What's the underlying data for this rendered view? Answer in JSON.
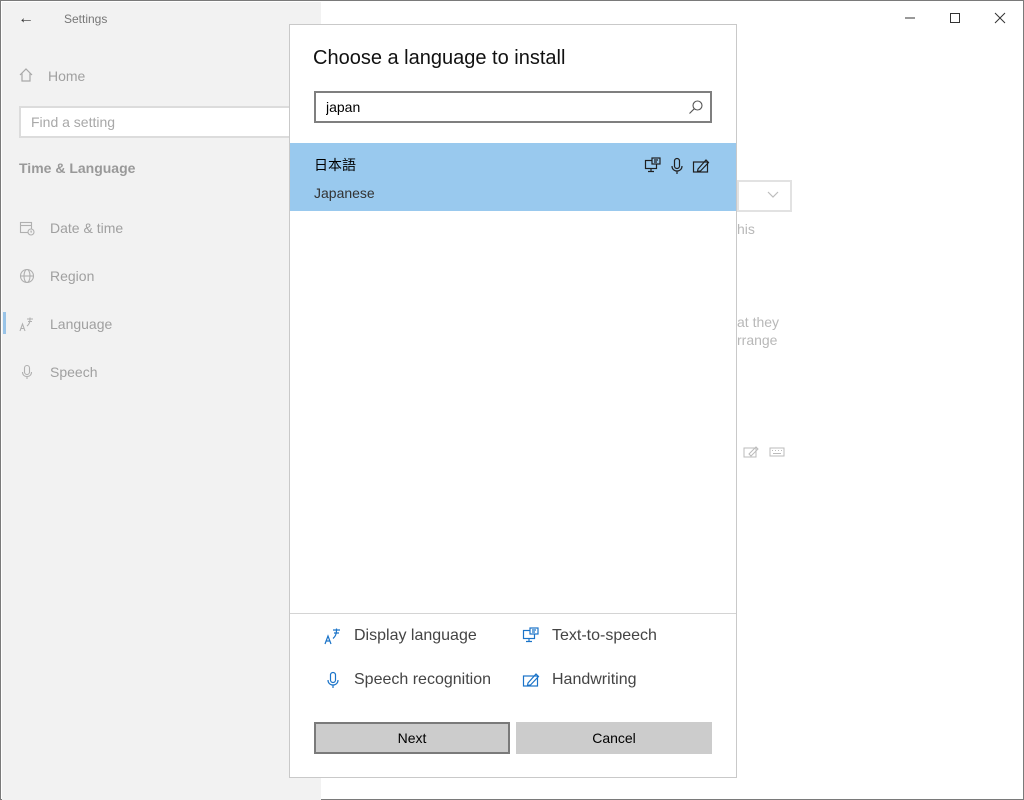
{
  "window": {
    "app_title": "Settings",
    "back_glyph": "←",
    "minimize_glyph": "—",
    "maximize_glyph": "☐",
    "close_glyph": "✕"
  },
  "sidebar": {
    "home_label": "Home",
    "search_placeholder": "Find a setting",
    "section_title": "Time & Language",
    "items": [
      {
        "label": "Date & time",
        "icon": "calendar-clock-icon"
      },
      {
        "label": "Region",
        "icon": "globe-icon"
      },
      {
        "label": "Language",
        "icon": "language-icon",
        "active": true
      },
      {
        "label": "Speech",
        "icon": "microphone-icon"
      }
    ]
  },
  "background": {
    "text_1": "his",
    "text_2": "at they",
    "text_3": "rrange"
  },
  "dialog": {
    "title": "Choose a language to install",
    "search_value": "japan",
    "results": [
      {
        "native": "日本語",
        "english": "Japanese",
        "features": [
          "text-to-speech",
          "speech-recognition",
          "handwriting"
        ]
      }
    ],
    "legend": {
      "display_language": "Display language",
      "text_to_speech": "Text-to-speech",
      "speech_recognition": "Speech recognition",
      "handwriting": "Handwriting"
    },
    "next_label": "Next",
    "cancel_label": "Cancel"
  },
  "colors": {
    "selection": "#99c9ee",
    "accent_icon": "#1a73c8",
    "sidebar_bg": "#f2f2f2",
    "button_bg": "#cccccc"
  }
}
